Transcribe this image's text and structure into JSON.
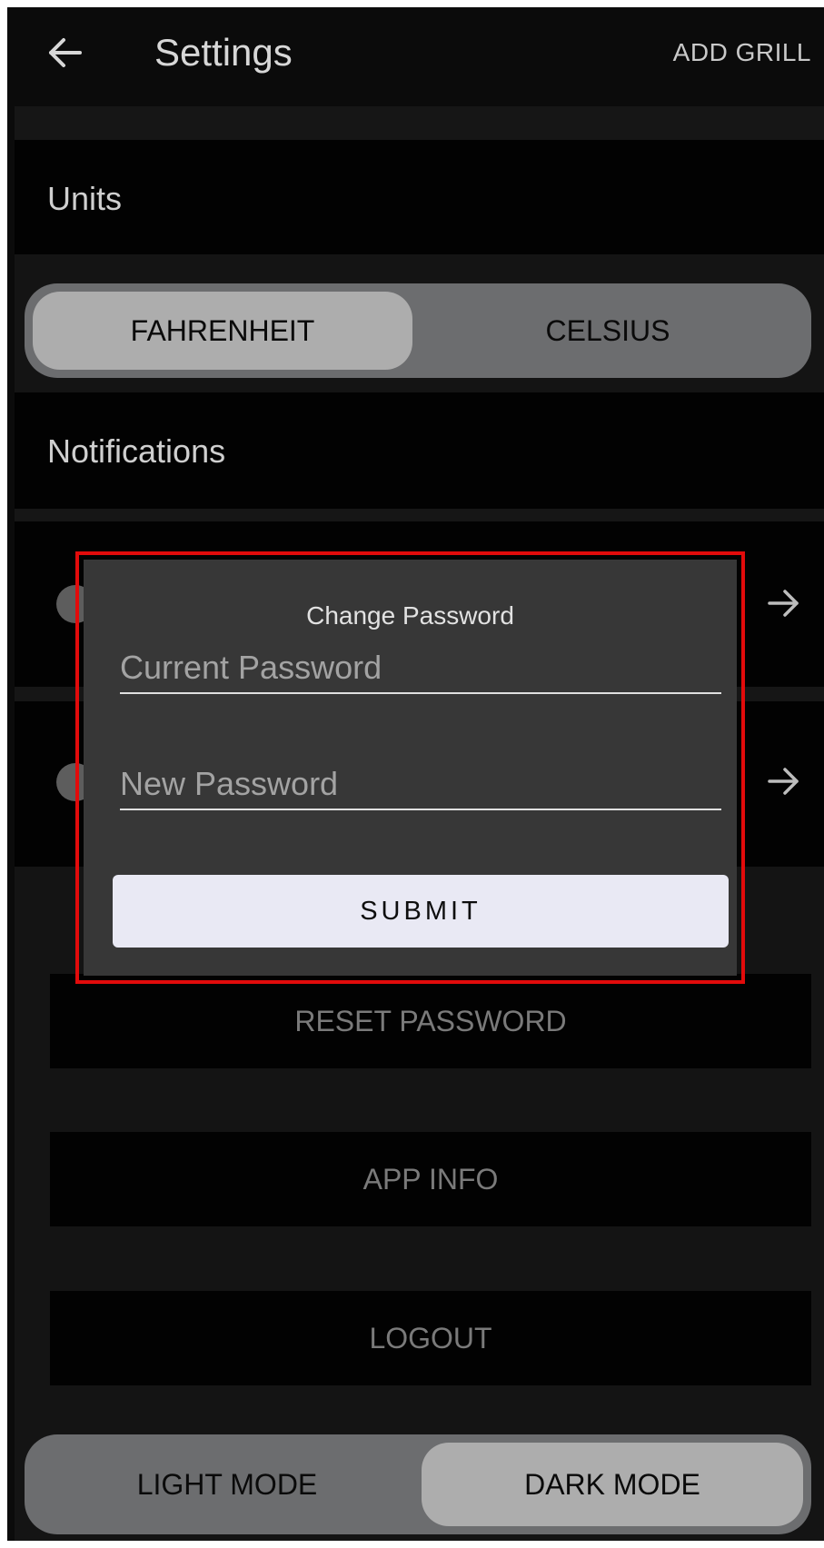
{
  "header": {
    "title": "Settings",
    "add_grill_label": "ADD GRILL",
    "back_icon": "arrow-left-icon"
  },
  "units": {
    "section_label": "Units",
    "options": [
      "FAHRENHEIT",
      "CELSIUS"
    ],
    "selected": "FAHRENHEIT"
  },
  "notifications": {
    "section_label": "Notifications",
    "row_icon": "arrow-right-icon"
  },
  "actions": {
    "reset_password": "RESET PASSWORD",
    "app_info": "APP INFO",
    "logout": "LOGOUT"
  },
  "theme": {
    "options": [
      "LIGHT MODE",
      "DARK MODE"
    ],
    "selected": "DARK MODE"
  },
  "modal": {
    "title": "Change Password",
    "current_password_placeholder": "Current Password",
    "new_password_placeholder": "New Password",
    "submit_label": "SUBMIT"
  },
  "colors": {
    "background": "#0b0b0b",
    "segment_track": "#6c6d6f",
    "segment_active": "#adadad",
    "modal_bg": "#373737",
    "highlight": "#e20b0b",
    "submit_bg": "#e9e9f4"
  }
}
